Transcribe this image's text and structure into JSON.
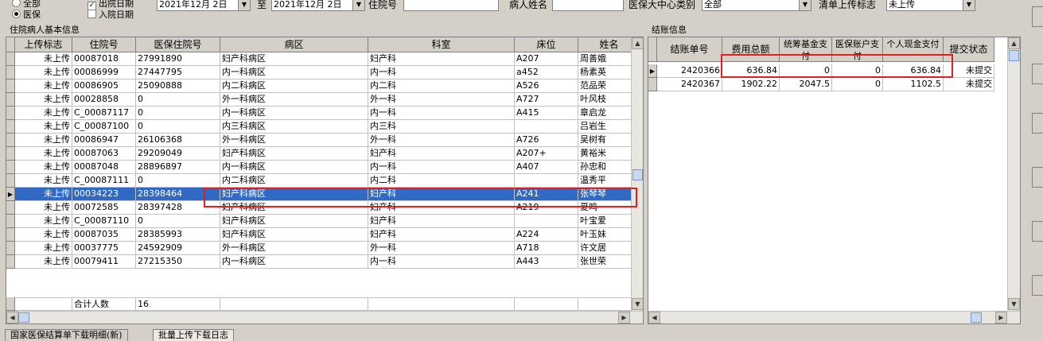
{
  "filters": {
    "radio_all": "全部",
    "radio_medical": "医保",
    "chk_discharge": "出院日期",
    "chk_admit": "入院日期",
    "date_from": "2021年12月 2日",
    "date_to_label": "至",
    "date_to": "2021年12月 2日",
    "admission_label": "住院号",
    "patient_name_label": "病人姓名",
    "center_category_label": "医保大中心类别",
    "center_category_value": "全部",
    "upload_flag_label": "清单上传标志",
    "upload_flag_value": "未上传"
  },
  "left_panel": {
    "title": "住院病人基本信息",
    "columns": [
      "上传标志",
      "住院号",
      "医保住院号",
      "病区",
      "科室",
      "床位",
      "姓名"
    ],
    "rows": [
      [
        "未上传",
        "00087018",
        "27991890",
        "妇产科病区",
        "妇产科",
        "A207",
        "周善娥"
      ],
      [
        "未上传",
        "00086999",
        "27447795",
        "内一科病区",
        "内一科",
        "a452",
        "杨素英"
      ],
      [
        "未上传",
        "00086905",
        "25090888",
        "内二科病区",
        "内二科",
        "A526",
        "范品荣"
      ],
      [
        "未上传",
        "00028858",
        "0",
        "外一科病区",
        "外一科",
        "A727",
        "叶风枝"
      ],
      [
        "未上传",
        "C_00087117",
        "0",
        "内一科病区",
        "内一科",
        "A415",
        "章启龙"
      ],
      [
        "未上传",
        "C_00087100",
        "0",
        "内三科病区",
        "内三科",
        "",
        "吕岩生"
      ],
      [
        "未上传",
        "00086947",
        "26106368",
        "外一科病区",
        "外一科",
        "A726",
        "吴树有"
      ],
      [
        "未上传",
        "00087063",
        "29209049",
        "妇产科病区",
        "妇产科",
        "A207+",
        "黄裕米"
      ],
      [
        "未上传",
        "00087048",
        "28896897",
        "内一科病区",
        "内一科",
        "A407",
        "孙忠和"
      ],
      [
        "未上传",
        "C_00087111",
        "0",
        "内二科病区",
        "内二科",
        "",
        "温秀平"
      ],
      [
        "未上传",
        "00034223",
        "28398464",
        "妇产科病区",
        "妇产科",
        "A241",
        "张琴琴"
      ],
      [
        "未上传",
        "00072585",
        "28397428",
        "妇产科病区",
        "妇产科",
        "A219",
        "夏鸣"
      ],
      [
        "未上传",
        "C_00087110",
        "0",
        "妇产科病区",
        "妇产科",
        "",
        "叶宝爱"
      ],
      [
        "未上传",
        "00087035",
        "28385993",
        "妇产科病区",
        "妇产科",
        "A224",
        "叶玉妹"
      ],
      [
        "未上传",
        "00037775",
        "24592909",
        "外一科病区",
        "外一科",
        "A718",
        "许文居"
      ],
      [
        "未上传",
        "00079411",
        "27215350",
        "内一科病区",
        "内一科",
        "A443",
        "张世荣"
      ]
    ],
    "selected_row": 10,
    "footer_label": "合计人数",
    "footer_value": "16"
  },
  "right_panel": {
    "title": "结账信息",
    "columns": [
      "结账单号",
      "费用总额",
      "统筹基金支付",
      "医保账户支付",
      "个人现金支付",
      "提交状态"
    ],
    "rows": [
      [
        "2420366",
        "636.84",
        "0",
        "0",
        "636.84",
        "未提交"
      ],
      [
        "2420367",
        "1902.22",
        "2047.5",
        "0",
        "1102.5",
        "未提交"
      ]
    ]
  },
  "tabs": [
    "国家医保结算单下载明细(新)",
    "批量上传下载日志"
  ],
  "colors": {
    "selection": "#316ac5",
    "highlight_box": "#e02020"
  }
}
